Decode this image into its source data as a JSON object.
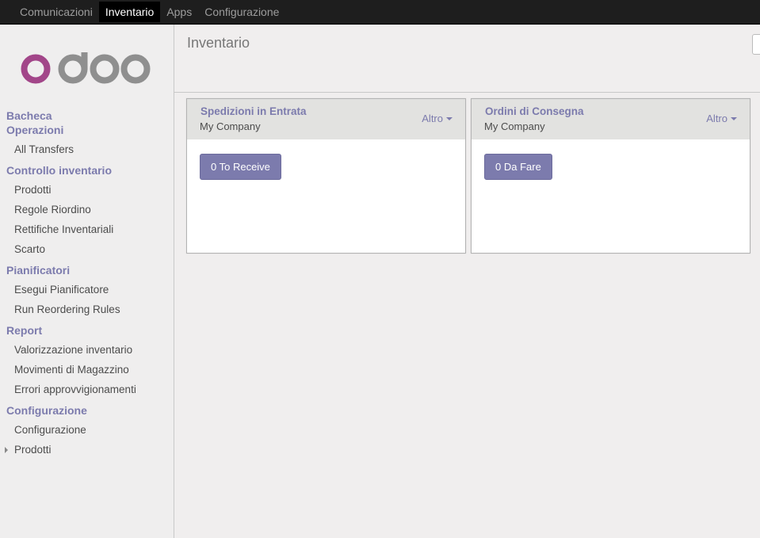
{
  "topbar": {
    "menu": [
      {
        "label": "Comunicazioni",
        "active": false
      },
      {
        "label": "Inventario",
        "active": true
      },
      {
        "label": "Apps",
        "active": false
      },
      {
        "label": "Configurazione",
        "active": false
      }
    ]
  },
  "sidebar": {
    "logo_text": "odoo",
    "sections": [
      {
        "title": "Bacheca",
        "items": []
      },
      {
        "title": "Operazioni",
        "items": [
          "All Transfers"
        ]
      },
      {
        "title": "Controllo inventario",
        "items": [
          "Prodotti",
          "Regole Riordino",
          "Rettifiche Inventariali",
          "Scarto"
        ]
      },
      {
        "title": "Pianificatori",
        "items": [
          "Esegui Pianificatore",
          "Run Reordering Rules"
        ]
      },
      {
        "title": "Report",
        "items": [
          "Valorizzazione inventario",
          "Movimenti di Magazzino",
          "Errori approvvigionamenti"
        ]
      },
      {
        "title": "Configurazione",
        "items": [
          "Configurazione",
          "Prodotti"
        ]
      }
    ]
  },
  "main": {
    "title": "Inventario",
    "cards": [
      {
        "title": "Spedizioni in Entrata",
        "company": "My Company",
        "more_label": "Altro",
        "button_label": "0 To Receive"
      },
      {
        "title": "Ordini di Consegna",
        "company": "My Company",
        "more_label": "Altro",
        "button_label": "0 Da Fare"
      }
    ]
  },
  "colors": {
    "topbar_bg": "#1e1e1e",
    "accent": "#7c7bad",
    "logo_o": "#a24689",
    "logo_doo": "#8f8f8f"
  }
}
